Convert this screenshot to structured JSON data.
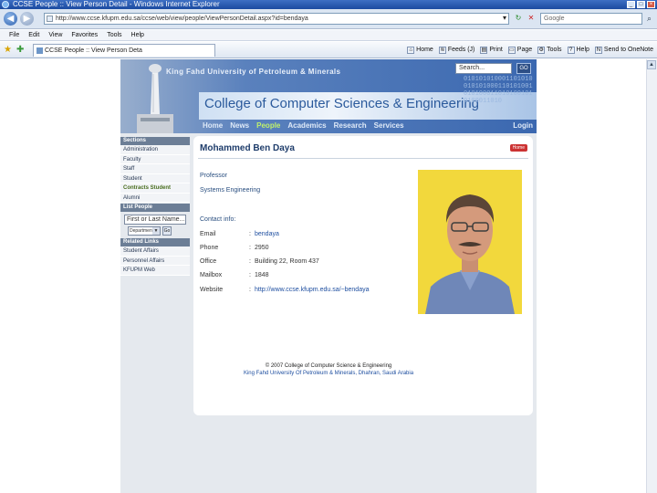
{
  "browser": {
    "window_title": "CCSE People :: View Person Detail - Windows Internet Explorer",
    "url": "http://www.ccse.kfupm.edu.sa/ccse/web/view/people/ViewPersonDetail.aspx?id=bendaya",
    "search_placeholder": "Google",
    "menu": [
      "File",
      "Edit",
      "View",
      "Favorites",
      "Tools",
      "Help"
    ],
    "tab_title": "CCSE People :: View Person Deta",
    "commands": [
      "Home",
      "Feeds (J)",
      "Print",
      "Page",
      "Tools",
      "Help",
      "Send to OneNote"
    ]
  },
  "site": {
    "university_name": "King Fahd University of Petroleum & Minerals",
    "college_name": "College of Computer Sciences & Engineering",
    "binary_text": "0101010100011010100101010001101010010101000110101001010100011010",
    "search_value": "Search...",
    "search_button": "GO",
    "nav": [
      "Home",
      "News",
      "People",
      "Academics",
      "Research",
      "Services"
    ],
    "login": "Login"
  },
  "sidebar": {
    "sections_heading": "Sections",
    "sections": [
      "Administration",
      "Faculty",
      "Staff",
      "Student",
      "Contracts Student",
      "Alumni"
    ],
    "list_people_heading": "List People",
    "name_input_value": "First or Last Name...",
    "dept_select_value": "Department",
    "go_label": "Go",
    "related_heading": "Related Links",
    "related": [
      "Student Affairs",
      "Personnel Affairs",
      "KFUPM Web"
    ]
  },
  "person": {
    "name": "Mohammed Ben Daya",
    "home_button": "Home",
    "title": "Professor",
    "department": "Systems Engineering",
    "contact_heading": "Contact info:",
    "contacts": [
      {
        "label": "Email",
        "sep": ":",
        "value": "bendaya"
      },
      {
        "label": "Phone",
        "sep": ":",
        "value": "2950"
      },
      {
        "label": "Office",
        "sep": ":",
        "value": "Building 22, Room 437"
      },
      {
        "label": "Mailbox",
        "sep": ":",
        "value": "1848"
      },
      {
        "label": "Website",
        "sep": ":",
        "value": "http://www.ccse.kfupm.edu.sa/~bendaya"
      }
    ]
  },
  "footer": {
    "copyright": "© 2007 College of Computer Science & Engineering",
    "address": "King Fahd University Of Petroleum & Minerals, Dhahran, Saudi Arabia"
  }
}
